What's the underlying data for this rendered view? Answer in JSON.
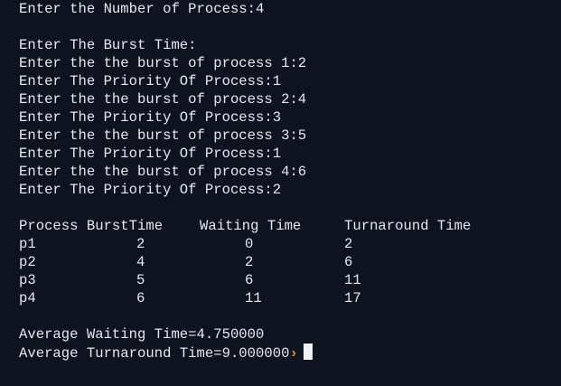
{
  "input": {
    "num_process_line": "Enter the Number of Process:4",
    "burst_header": "Enter The Burst Time:",
    "entries": [
      "Enter the the burst of process 1:2",
      "Enter The Priority Of Process:1",
      "Enter the the burst of process 2:4",
      "Enter The Priority Of Process:3",
      "Enter the the burst of process 3:5",
      "Enter The Priority Of Process:1",
      "Enter the the burst of process 4:6",
      "Enter The Priority Of Process:2"
    ]
  },
  "table": {
    "headers": {
      "process_burst": "Process BurstTime",
      "waiting": "Waiting Time",
      "turnaround": "Turnaround Time"
    },
    "rows": [
      {
        "process": "p1",
        "burst": "2",
        "waiting": "0",
        "turnaround": "2"
      },
      {
        "process": "p2",
        "burst": "4",
        "waiting": "2",
        "turnaround": "6"
      },
      {
        "process": "p3",
        "burst": "5",
        "waiting": "6",
        "turnaround": "11"
      },
      {
        "process": "p4",
        "burst": "6",
        "waiting": "11",
        "turnaround": "17"
      }
    ]
  },
  "summary": {
    "avg_waiting": "Average Waiting Time=4.750000",
    "avg_turnaround": "Average Turnaround Time=9.000000"
  },
  "prompt": {
    "symbol": "›"
  },
  "colors": {
    "background": "#0d1420",
    "text": "#e6e8ee",
    "prompt": "#f28a2c",
    "cursor": "#f2f2f2"
  }
}
